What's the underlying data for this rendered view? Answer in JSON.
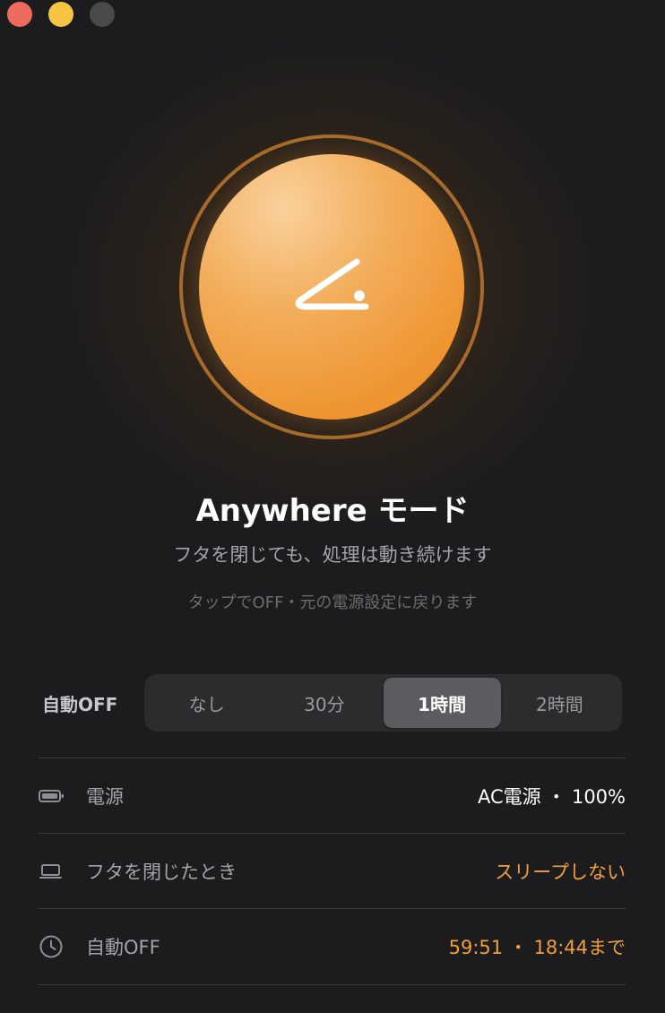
{
  "window": {
    "controls": [
      "close",
      "minimize",
      "zoom"
    ]
  },
  "hero": {
    "icon": "lid-open-icon",
    "accent": "#ee9532",
    "title": "Anywhere モード",
    "subtitle": "フタを閉じても、処理は動き続けます",
    "hint": "タップでOFF・元の電源設定に戻ります"
  },
  "auto_off": {
    "label": "自動OFF",
    "options": [
      "なし",
      "30分",
      "1時間",
      "2時間"
    ],
    "selected": "1時間"
  },
  "status": {
    "power": {
      "icon": "battery-icon",
      "label": "電源",
      "value": "AC電源 ・ 100%"
    },
    "lid": {
      "icon": "laptop-icon",
      "label": "フタを閉じたとき",
      "value": "スリープしない"
    },
    "timer": {
      "icon": "clock-icon",
      "label": "自動OFF",
      "value": "59:51 ・ 18:44まで"
    }
  }
}
